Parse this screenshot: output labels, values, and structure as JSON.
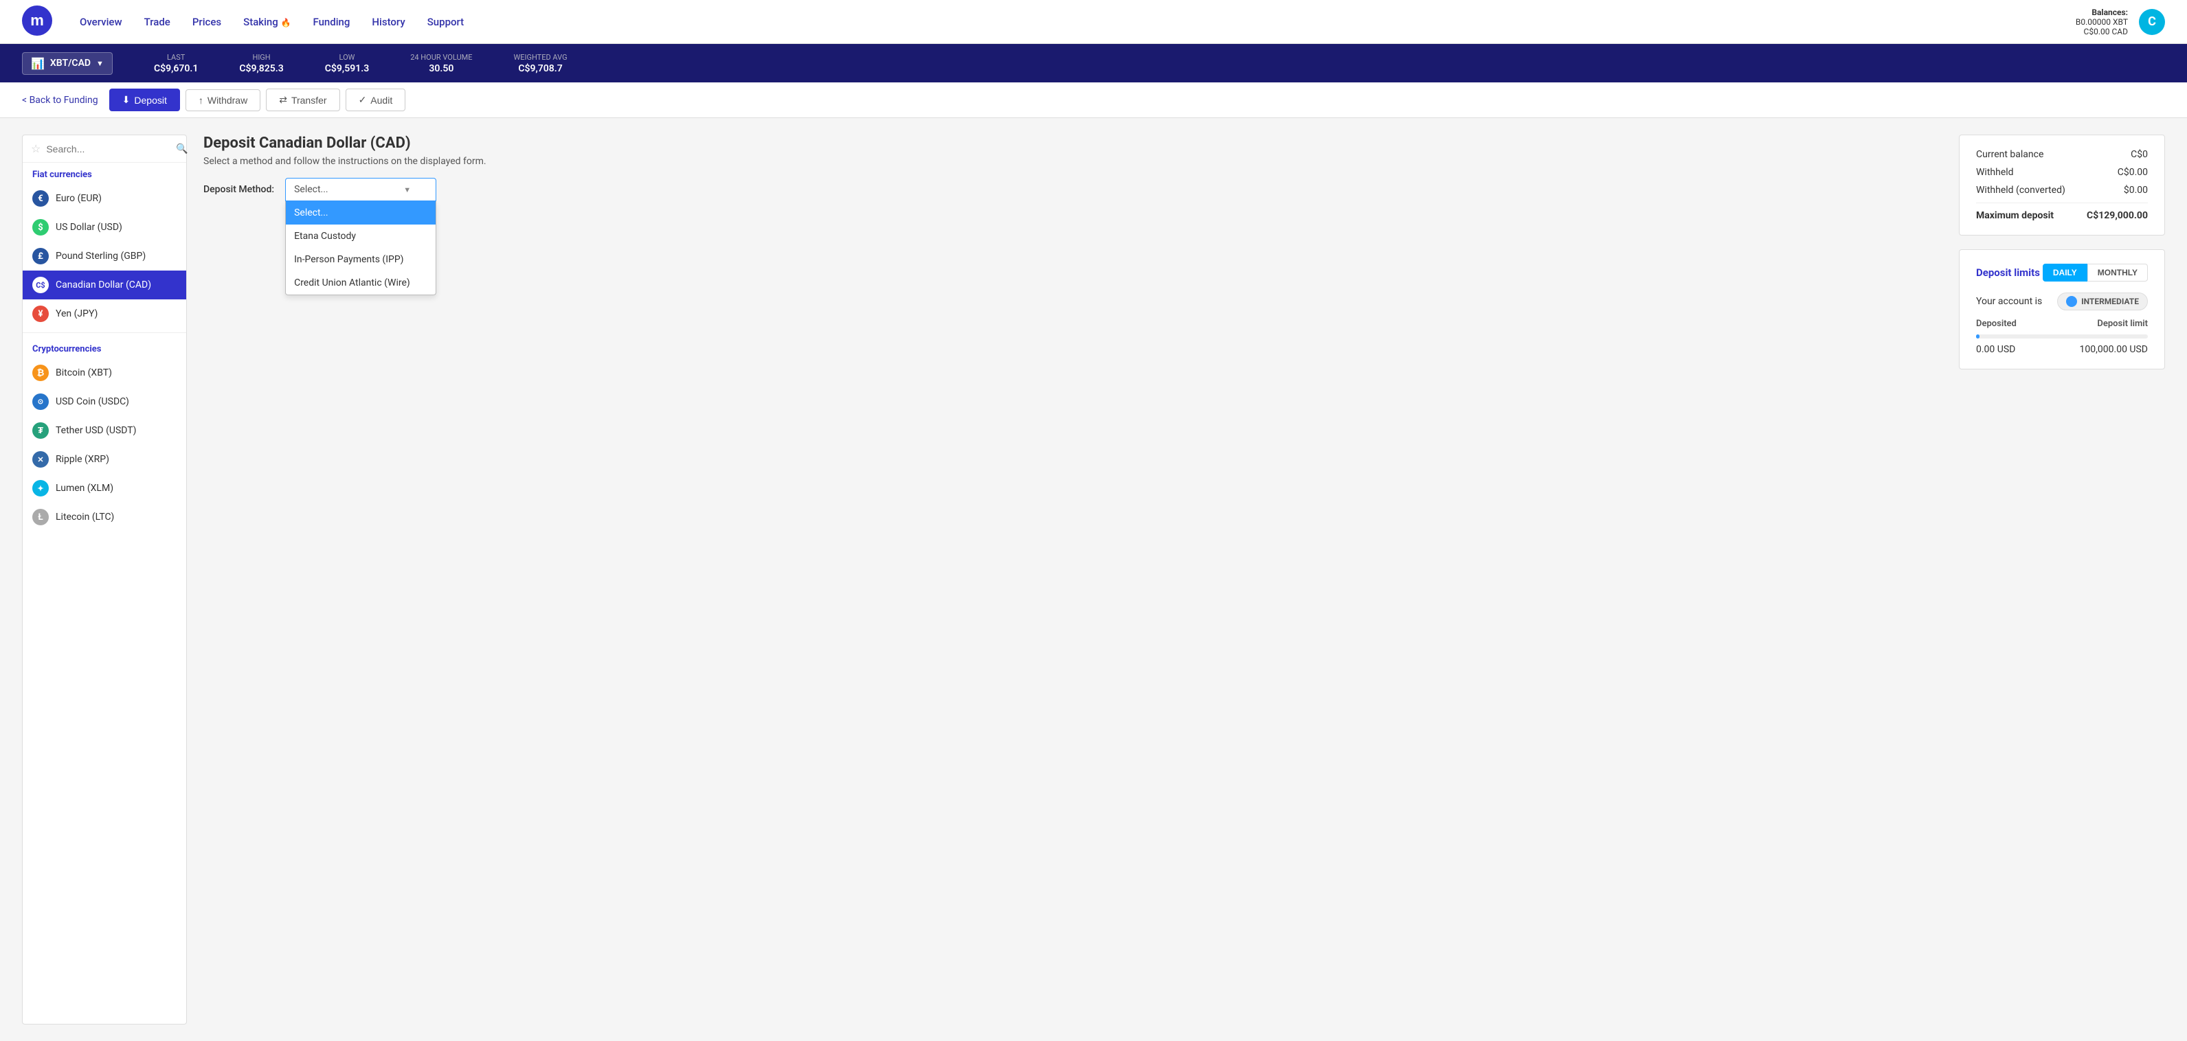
{
  "header": {
    "logo_alt": "Coinsquare logo",
    "nav_items": [
      {
        "label": "Overview",
        "id": "overview"
      },
      {
        "label": "Trade",
        "id": "trade"
      },
      {
        "label": "Prices",
        "id": "prices"
      },
      {
        "label": "Staking",
        "id": "staking",
        "has_icon": true
      },
      {
        "label": "Funding",
        "id": "funding"
      },
      {
        "label": "History",
        "id": "history"
      },
      {
        "label": "Support",
        "id": "support"
      }
    ],
    "balances_label": "Balances:",
    "balance_xbt": "B0.00000 XBT",
    "balance_cad": "C$0.00 CAD",
    "avatar_letter": "C"
  },
  "ticker": {
    "pair": "XBT/CAD",
    "last_label": "Last",
    "last_value": "C$9,670.1",
    "high_label": "High",
    "high_value": "C$9,825.3",
    "low_label": "Low",
    "low_value": "C$9,591.3",
    "volume_label": "24 Hour Volume",
    "volume_value": "30.50",
    "wavg_label": "Weighted Avg",
    "wavg_value": "C$9,708.7"
  },
  "subnav": {
    "back_label": "< Back to Funding",
    "deposit_label": "Deposit",
    "withdraw_label": "Withdraw",
    "transfer_label": "Transfer",
    "audit_label": "Audit"
  },
  "sidebar": {
    "search_placeholder": "Search...",
    "fiat_section_title": "Fiat currencies",
    "fiat_items": [
      {
        "label": "Euro (EUR)",
        "id": "eur",
        "icon": "€",
        "icon_class": "icon-eur"
      },
      {
        "label": "US Dollar (USD)",
        "id": "usd",
        "icon": "$",
        "icon_class": "icon-usd"
      },
      {
        "label": "Pound Sterling (GBP)",
        "id": "gbp",
        "icon": "£",
        "icon_class": "icon-gbp"
      },
      {
        "label": "Canadian Dollar (CAD)",
        "id": "cad",
        "icon": "C$",
        "icon_class": "icon-cad",
        "active": true
      },
      {
        "label": "Yen (JPY)",
        "id": "jpy",
        "icon": "¥",
        "icon_class": "icon-jpy"
      }
    ],
    "crypto_section_title": "Cryptocurrencies",
    "crypto_items": [
      {
        "label": "Bitcoin (XBT)",
        "id": "xbt",
        "icon": "₿",
        "icon_class": "icon-btc"
      },
      {
        "label": "USD Coin (USDC)",
        "id": "usdc",
        "icon": "⊙",
        "icon_class": "icon-usdc"
      },
      {
        "label": "Tether USD (USDT)",
        "id": "usdt",
        "icon": "₮",
        "icon_class": "icon-usdt"
      },
      {
        "label": "Ripple (XRP)",
        "id": "xrp",
        "icon": "✕",
        "icon_class": "icon-xrp"
      },
      {
        "label": "Lumen (XLM)",
        "id": "xlm",
        "icon": "★",
        "icon_class": "icon-xlm"
      },
      {
        "label": "Litecoin (LTC)",
        "id": "ltc",
        "icon": "Ł",
        "icon_class": "icon-ltc"
      }
    ]
  },
  "deposit_form": {
    "title": "Deposit Canadian Dollar (CAD)",
    "subtitle": "Select a method and follow the instructions on the displayed form.",
    "method_label": "Deposit Method:",
    "method_placeholder": "Select...",
    "dropdown_options": [
      {
        "label": "Select...",
        "value": "",
        "selected": true
      },
      {
        "label": "Etana Custody",
        "value": "etana"
      },
      {
        "label": "In-Person Payments (IPP)",
        "value": "ipp"
      },
      {
        "label": "Credit Union Atlantic (Wire)",
        "value": "cua"
      }
    ]
  },
  "balance_card": {
    "current_balance_label": "Current balance",
    "current_balance_value": "C$0",
    "withheld_label": "Withheld",
    "withheld_value": "C$0.00",
    "withheld_converted_label": "Withheld (converted)",
    "withheld_converted_value": "$0.00",
    "max_deposit_label": "Maximum deposit",
    "max_deposit_value": "C$129,000.00"
  },
  "limits_card": {
    "title": "Deposit limits",
    "tab_daily": "DAILY",
    "tab_monthly": "MONTHLY",
    "account_label": "Your account is",
    "account_level": "INTERMEDIATE",
    "deposited_label": "Deposited",
    "limit_label": "Deposit limit",
    "deposited_value": "0.00  USD",
    "limit_value": "100,000.00  USD",
    "progress_pct": 0
  }
}
